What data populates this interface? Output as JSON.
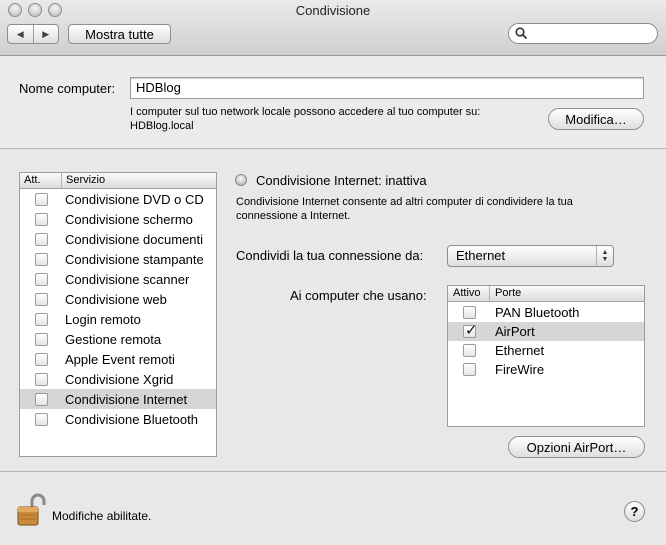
{
  "window": {
    "title": "Condivisione"
  },
  "toolbar": {
    "back_glyph": "◀",
    "forward_glyph": "▶",
    "show_all_label": "Mostra tutte",
    "search_placeholder": ""
  },
  "computer_name": {
    "label": "Nome computer:",
    "value": "HDBlog",
    "info_line1": "I computer sul tuo network locale possono accedere al tuo computer su:",
    "info_line2": "HDBlog.local",
    "edit_button": "Modifica…"
  },
  "services": {
    "headers": [
      "Att.",
      "Servizio"
    ],
    "items": [
      {
        "name": "Condivisione DVD o CD",
        "checked": false,
        "selected": false
      },
      {
        "name": "Condivisione schermo",
        "checked": false,
        "selected": false
      },
      {
        "name": "Condivisione documenti",
        "checked": false,
        "selected": false
      },
      {
        "name": "Condivisione stampante",
        "checked": false,
        "selected": false
      },
      {
        "name": "Condivisione scanner",
        "checked": false,
        "selected": false
      },
      {
        "name": "Condivisione web",
        "checked": false,
        "selected": false
      },
      {
        "name": "Login remoto",
        "checked": false,
        "selected": false
      },
      {
        "name": "Gestione remota",
        "checked": false,
        "selected": false
      },
      {
        "name": "Apple Event remoti",
        "checked": false,
        "selected": false
      },
      {
        "name": "Condivisione Xgrid",
        "checked": false,
        "selected": false
      },
      {
        "name": "Condivisione Internet",
        "checked": false,
        "selected": true
      },
      {
        "name": "Condivisione Bluetooth",
        "checked": false,
        "selected": false
      }
    ]
  },
  "detail": {
    "status": "Condivisione Internet: inattiva",
    "description_line1": "Condivisione Internet consente ad altri computer di condividere la tua",
    "description_line2": "connessione a Internet.",
    "share_from_label": "Condividi la tua connessione da:",
    "share_from_value": "Ethernet",
    "to_computers_label": "Ai computer che usano:",
    "ports_headers": [
      "Attivo",
      "Porte"
    ],
    "ports": [
      {
        "name": "PAN Bluetooth",
        "checked": false,
        "selected": false
      },
      {
        "name": "AirPort",
        "checked": true,
        "selected": true
      },
      {
        "name": "Ethernet",
        "checked": false,
        "selected": false
      },
      {
        "name": "FireWire",
        "checked": false,
        "selected": false
      }
    ],
    "airport_options_button": "Opzioni AirPort…"
  },
  "footer": {
    "lock_text": "Modifiche abilitate.",
    "help_glyph": "?"
  }
}
